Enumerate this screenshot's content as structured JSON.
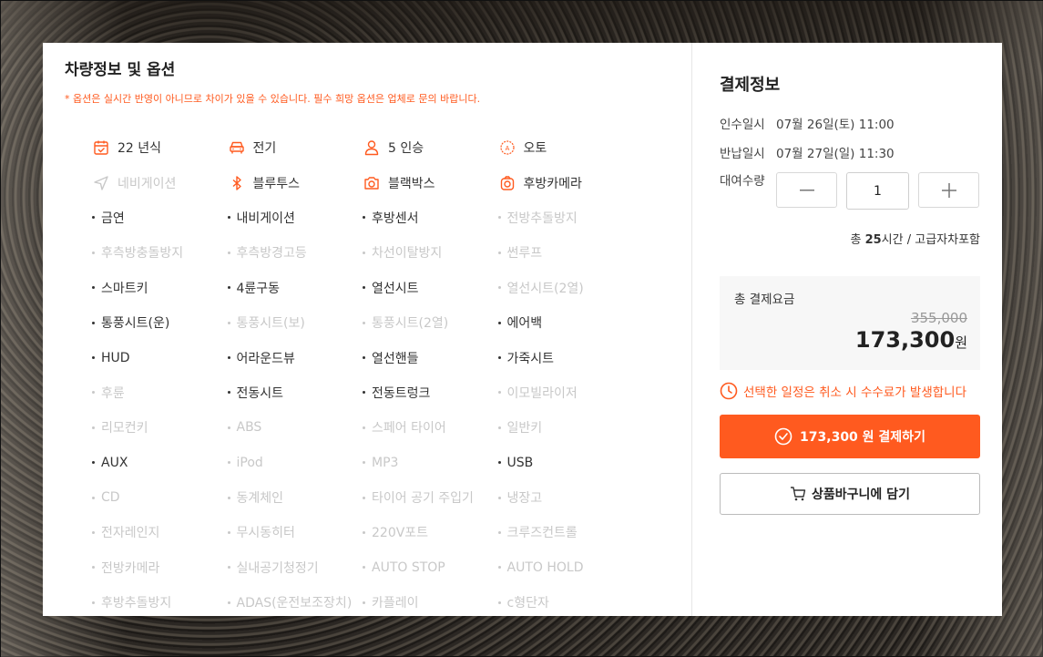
{
  "options_section": {
    "title": "차량정보 및 옵션",
    "notice": "* 옵션은 실시간 반영이 아니므로 차이가 있을 수 있습니다. 필수 희망 옵션은 업체로 문의 바랍니다.",
    "accent_color": "#ff5a1f",
    "icon_items": [
      {
        "label": "22 년식",
        "icon": "calendar-check-icon",
        "active": true
      },
      {
        "label": "전기",
        "icon": "car-front-icon",
        "active": true
      },
      {
        "label": "5 인승",
        "icon": "person-icon",
        "active": true
      },
      {
        "label": "오토",
        "icon": "auto-transmission-icon",
        "active": true
      },
      {
        "label": "네비게이션",
        "icon": "navigation-arrow-icon",
        "active": false
      },
      {
        "label": "블루투스",
        "icon": "bluetooth-icon",
        "active": true
      },
      {
        "label": "블랙박스",
        "icon": "dashcam-icon",
        "active": true
      },
      {
        "label": "후방카메라",
        "icon": "rear-camera-icon",
        "active": true
      }
    ],
    "option_items": [
      {
        "label": "금연",
        "active": true
      },
      {
        "label": "내비게이션",
        "active": true
      },
      {
        "label": "후방센서",
        "active": true
      },
      {
        "label": "전방추돌방지",
        "active": false
      },
      {
        "label": "후측방충돌방지",
        "active": false
      },
      {
        "label": "후측방경고등",
        "active": false
      },
      {
        "label": "차선이탈방지",
        "active": false
      },
      {
        "label": "썬루프",
        "active": false
      },
      {
        "label": "스마트키",
        "active": true
      },
      {
        "label": "4륜구동",
        "active": true
      },
      {
        "label": "열선시트",
        "active": true
      },
      {
        "label": "열선시트(2열)",
        "active": false
      },
      {
        "label": "통풍시트(운)",
        "active": true
      },
      {
        "label": "통풍시트(보)",
        "active": false
      },
      {
        "label": "통풍시트(2열)",
        "active": false
      },
      {
        "label": "에어백",
        "active": true
      },
      {
        "label": "HUD",
        "active": true
      },
      {
        "label": "어라운드뷰",
        "active": true
      },
      {
        "label": "열선핸들",
        "active": true
      },
      {
        "label": "가죽시트",
        "active": true
      },
      {
        "label": "후륜",
        "active": false
      },
      {
        "label": "전동시트",
        "active": true
      },
      {
        "label": "전동트렁크",
        "active": true
      },
      {
        "label": "이모빌라이저",
        "active": false
      },
      {
        "label": "리모컨키",
        "active": false
      },
      {
        "label": "ABS",
        "active": false
      },
      {
        "label": "스페어 타이어",
        "active": false
      },
      {
        "label": "일반키",
        "active": false
      },
      {
        "label": "AUX",
        "active": true
      },
      {
        "label": "iPod",
        "active": false
      },
      {
        "label": "MP3",
        "active": false
      },
      {
        "label": "USB",
        "active": true
      },
      {
        "label": "CD",
        "active": false
      },
      {
        "label": "동계체인",
        "active": false
      },
      {
        "label": "타이어 공기 주입기",
        "active": false
      },
      {
        "label": "냉장고",
        "active": false
      },
      {
        "label": "전자레인지",
        "active": false
      },
      {
        "label": "무시동히터",
        "active": false
      },
      {
        "label": "220V포트",
        "active": false
      },
      {
        "label": "크루즈컨트롤",
        "active": false
      },
      {
        "label": "전방카메라",
        "active": false
      },
      {
        "label": "실내공기청정기",
        "active": false
      },
      {
        "label": "AUTO STOP",
        "active": false
      },
      {
        "label": "AUTO HOLD",
        "active": false
      },
      {
        "label": "후방추돌방지",
        "active": false
      },
      {
        "label": "ADAS(운전보조장치)",
        "active": false
      },
      {
        "label": "카플레이",
        "active": false
      },
      {
        "label": "c형단자",
        "active": false
      }
    ]
  },
  "payment": {
    "title": "결제정보",
    "pickup_label": "인수일시",
    "pickup_value": "07월 26일(토) 11:00",
    "return_label": "반납일시",
    "return_value": "07월 27일(일) 11:30",
    "qty_label": "대여수량",
    "qty_value": "1",
    "minus_symbol": "—",
    "plus_symbol": "+",
    "hours_prefix": "총 ",
    "hours_value": "25",
    "hours_suffix": "시간 / 고급자차포함",
    "total_label": "총 결제요금",
    "original_price": "355,000",
    "final_price": "173,300",
    "currency": "원",
    "warning": "선택한 일정은 취소 시 수수료가 발생합니다",
    "pay_button": "173,300 원 결제하기",
    "cart_button": "상품바구니에 담기"
  }
}
